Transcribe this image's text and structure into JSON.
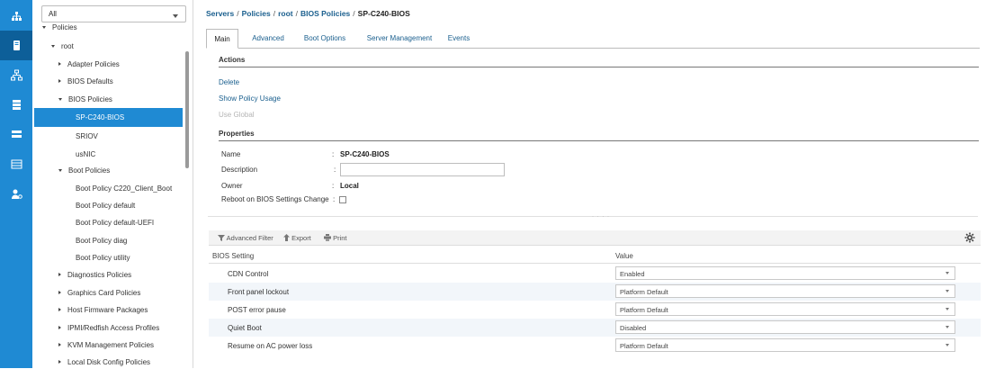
{
  "rail": {
    "items": [
      {
        "icon": "equipment-icon"
      },
      {
        "icon": "servers-icon"
      },
      {
        "icon": "lan-icon"
      },
      {
        "icon": "san-icon"
      },
      {
        "icon": "vm-icon"
      },
      {
        "icon": "storage-icon"
      },
      {
        "icon": "admin-icon"
      }
    ],
    "active_index": 1
  },
  "nav": {
    "filter_value": "All",
    "tree": [
      {
        "label": "Policies",
        "expander": "down",
        "level": 0,
        "partial": true
      },
      {
        "label": "root",
        "expander": "down",
        "level": 1
      },
      {
        "label": "Adapter Policies",
        "expander": "right",
        "level": 2
      },
      {
        "label": "BIOS Defaults",
        "expander": "right",
        "level": 2
      },
      {
        "label": "BIOS Policies",
        "expander": "down",
        "level": 2
      },
      {
        "label": "SP-C240-BIOS",
        "expander": "none",
        "level": 3,
        "selected": true
      },
      {
        "label": "SRIOV",
        "expander": "none",
        "level": 3
      },
      {
        "label": "usNIC",
        "expander": "none",
        "level": 3
      },
      {
        "label": "Boot Policies",
        "expander": "down",
        "level": 2
      },
      {
        "label": "Boot Policy C220_Client_Boot",
        "expander": "none",
        "level": 3
      },
      {
        "label": "Boot Policy default",
        "expander": "none",
        "level": 3
      },
      {
        "label": "Boot Policy default-UEFI",
        "expander": "none",
        "level": 3
      },
      {
        "label": "Boot Policy diag",
        "expander": "none",
        "level": 3
      },
      {
        "label": "Boot Policy utility",
        "expander": "none",
        "level": 3
      },
      {
        "label": "Diagnostics Policies",
        "expander": "right",
        "level": 2
      },
      {
        "label": "Graphics Card Policies",
        "expander": "right",
        "level": 2
      },
      {
        "label": "Host Firmware Packages",
        "expander": "right",
        "level": 2
      },
      {
        "label": "IPMI/Redfish Access Profiles",
        "expander": "right",
        "level": 2
      },
      {
        "label": "KVM Management Policies",
        "expander": "right",
        "level": 2
      },
      {
        "label": "Local Disk Config Policies",
        "expander": "right",
        "level": 2
      }
    ]
  },
  "breadcrumb": {
    "items": [
      "Servers",
      "Policies",
      "root",
      "BIOS Policies"
    ],
    "separator": "/",
    "current": "SP-C240-BIOS"
  },
  "tabs": [
    {
      "label": "Main",
      "active": true
    },
    {
      "label": "Advanced"
    },
    {
      "label": "Boot Options"
    },
    {
      "label": "Server Management"
    },
    {
      "label": "Events"
    }
  ],
  "actions": {
    "heading": "Actions",
    "delete": "Delete",
    "show_usage": "Show Policy Usage",
    "use_global": "Use Global"
  },
  "properties": {
    "heading": "Properties",
    "name_label": "Name",
    "name_value": "SP-C240-BIOS",
    "description_label": "Description",
    "description_value": "",
    "owner_label": "Owner",
    "owner_value": "Local",
    "reboot_label": "Reboot on BIOS Settings Change",
    "reboot_checked": false,
    "colon": ":"
  },
  "toolbar": {
    "advanced_filter": "Advanced Filter",
    "export": "Export",
    "print": "Print"
  },
  "grid": {
    "headers": [
      "BIOS Setting",
      "Value"
    ],
    "rows": [
      {
        "setting": "CDN Control",
        "value": "Enabled"
      },
      {
        "setting": "Front panel lockout",
        "value": "Platform Default"
      },
      {
        "setting": "POST error pause",
        "value": "Platform Default"
      },
      {
        "setting": "Quiet Boot",
        "value": "Disabled"
      },
      {
        "setting": "Resume on AC power loss",
        "value": "Platform Default"
      }
    ]
  },
  "colors": {
    "accent": "#1f8ad3",
    "rail_active": "#0d5f99",
    "link": "#1a5f8e"
  }
}
